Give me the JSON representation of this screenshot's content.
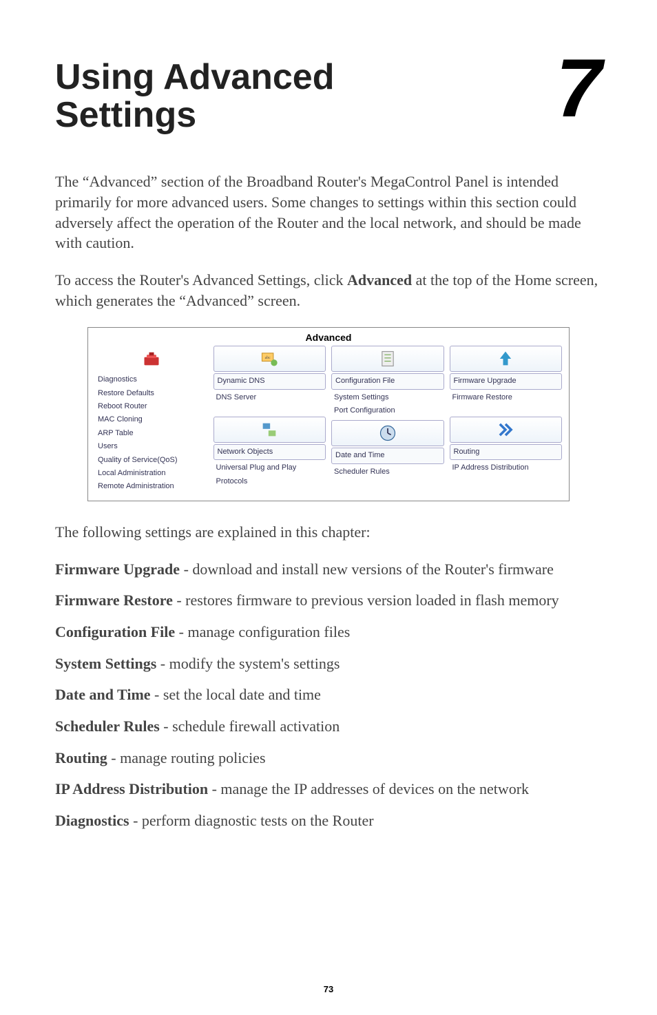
{
  "chapter": {
    "title_line1": "Using Advanced",
    "title_line2": "Settings",
    "number": "7"
  },
  "intro_para": "The “Advanced” section of the Broadband Router's MegaControl Panel is intended primarily for more advanced users. Some changes to settings within this section could adversely affect the operation of the Router and the local network, and should be made with caution.",
  "access_para_prefix": "To access the Router's Advanced Settings, click ",
  "access_para_bold": "Advanced",
  "access_para_suffix": " at the top of the Home screen, which generates the “Advanced” screen.",
  "panel": {
    "title": "Advanced",
    "col1": {
      "items": [
        "Diagnostics",
        "Restore Defaults",
        "Reboot Router",
        "MAC Cloning",
        "ARP Table",
        "Users",
        "Quality of Service(QoS)",
        "Local Administration",
        "Remote Administration"
      ]
    },
    "col2": {
      "top_items": [
        "Dynamic DNS",
        "DNS Server"
      ],
      "bottom_items": [
        "Network Objects",
        "Universal Plug and Play",
        "Protocols"
      ]
    },
    "col3": {
      "top_items": [
        "Configuration File",
        "System Settings",
        "Port Configuration"
      ],
      "bottom_items": [
        "Date and Time",
        "Scheduler Rules"
      ]
    },
    "col4": {
      "top_items": [
        "Firmware Upgrade",
        "Firmware Restore"
      ],
      "bottom_items": [
        "Routing",
        "IP Address Distribution"
      ]
    }
  },
  "explained_intro": "The following settings are explained in this chapter:",
  "settings": [
    {
      "label": "Firmware Upgrade",
      "desc": " - download and install new versions of the Router's firmware"
    },
    {
      "label": "Firmware Restore",
      "desc": " - restores firmware to previous version loaded in flash memory"
    },
    {
      "label": "Configuration File",
      "desc": " - manage configuration files"
    },
    {
      "label": "System Settings",
      "desc": " - modify the system's settings"
    },
    {
      "label": "Date and Time",
      "desc": " - set the local date and time"
    },
    {
      "label": "Scheduler Rules",
      "desc": " - schedule firewall activation"
    },
    {
      "label": "Routing",
      "desc": " - manage routing policies"
    },
    {
      "label": "IP Address Distribution",
      "desc": " - manage the IP addresses of devices on the network"
    },
    {
      "label": "Diagnostics",
      "desc": " - perform diagnostic tests on the Router"
    }
  ],
  "page_number": "73"
}
